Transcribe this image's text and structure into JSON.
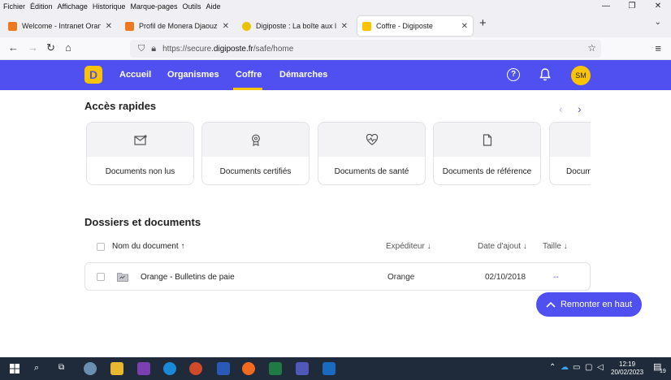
{
  "menubar": [
    "Fichier",
    "Édition",
    "Affichage",
    "Historique",
    "Marque-pages",
    "Outils",
    "Aide"
  ],
  "window_controls": {
    "minimize": "—",
    "restore": "❐",
    "close": "✕"
  },
  "tabs": [
    {
      "title": "Welcome - Intranet Orange",
      "fav_color": "#f07820"
    },
    {
      "title": "Profil de Monera Djaouzi - Ann",
      "fav_color": "#f07820"
    },
    {
      "title": "Digiposte : La boîte aux lettres",
      "fav_color": "#e8c200"
    },
    {
      "title": "Coffre - Digiposte",
      "fav_color": "#fcc400"
    }
  ],
  "url": {
    "prefix": "https://secure.",
    "domain": "digiposte.fr",
    "path": "/safe/home"
  },
  "app": {
    "logo": "D",
    "nav": [
      "Accueil",
      "Organismes",
      "Coffre",
      "Démarches"
    ],
    "help": "?",
    "avatar": "SM",
    "accent": "#5050f0",
    "yellow": "#fcc400"
  },
  "quick": {
    "title": "Accès rapides",
    "prev": "‹",
    "next": "›",
    "cards": [
      {
        "label": "Documents non lus",
        "icon": "envelope-icon"
      },
      {
        "label": "Documents certifiés",
        "icon": "badge-icon"
      },
      {
        "label": "Documents de santé",
        "icon": "heart-pulse-icon"
      },
      {
        "label": "Documents de référence",
        "icon": "document-icon"
      },
      {
        "label": "Docum",
        "icon": "more-icon"
      }
    ]
  },
  "docs": {
    "title": "Dossiers et documents",
    "headers": {
      "name": "Nom du document ↑",
      "sender": "Expéditeur ↓",
      "date": "Date d'ajout ↓",
      "size": "Taille ↓"
    },
    "rows": [
      {
        "name": "Orange - Bulletins de paie",
        "sender": "Orange",
        "date": "02/10/2018",
        "size": "--"
      }
    ]
  },
  "back_to_top": "Remonter en haut",
  "taskbar": {
    "time": "12:19",
    "date": "20/02/2023",
    "notif": "19"
  }
}
